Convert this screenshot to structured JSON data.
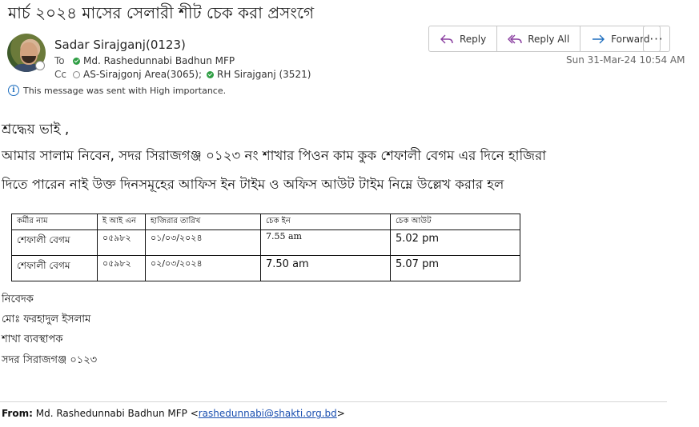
{
  "subject": "মার্চ ২০২৪ মাসের সেলারী শীট চেক করা প্রসংগে",
  "sender": {
    "name": "Sadar Sirajganj(0123)",
    "to_label": "To",
    "to": "Md. Rashedunnabi Badhun MFP",
    "cc_label": "Cc",
    "cc": [
      "AS-Sirajgonj Area(3065);",
      "RH Sirajganj (3521)"
    ]
  },
  "importance_note": "This message was sent with High importance.",
  "actions": {
    "reply": "Reply",
    "reply_all": "Reply All",
    "forward": "Forward",
    "more": "···"
  },
  "datetime": "Sun 31-Mar-24 10:54 AM",
  "body": {
    "greeting": "শ্রদ্ধেয় ভাই ,",
    "line1": "আমার সালাম নিবেন, সদর সিরাজগঞ্জ ০১২৩ নং শাখার পিওন কাম কুক শেফালী বেগম এর দিনে হাজিরা",
    "line2": "দিতে পারেন নাই উক্ত দিনসমূহের আফিস ইন টাইম ও অফিস আউট টাইম নিম্নে উল্লেখ করার হল"
  },
  "table": {
    "headers": [
      "কর্মীর নাম",
      "ই আই এন",
      "হাজিরার তারিখ",
      "চেক ইন",
      "চেক আউট"
    ],
    "rows": [
      [
        "শেফালী বেগম",
        "০৫৯৮২",
        "০১/০৩/২০২৪",
        "7.55 am",
        "5.02 pm"
      ],
      [
        "শেফালী বেগম",
        "০৫৯৮২",
        "০২/০৩/২০২৪",
        "7.50 am",
        "5.07 pm"
      ]
    ]
  },
  "signature": [
    "নিবেদক",
    "মোঃ ফরহাদুল ইসলাম",
    "শাখা ব্যবস্থাপক",
    "সদর সিরাজগঞ্জ ০১২৩"
  ],
  "forward_header": {
    "label": "From:",
    "name": "Md. Rashedunnabi Badhun MFP <",
    "email": "rashedunnabi@shakti.org.bd",
    "close": ">"
  }
}
